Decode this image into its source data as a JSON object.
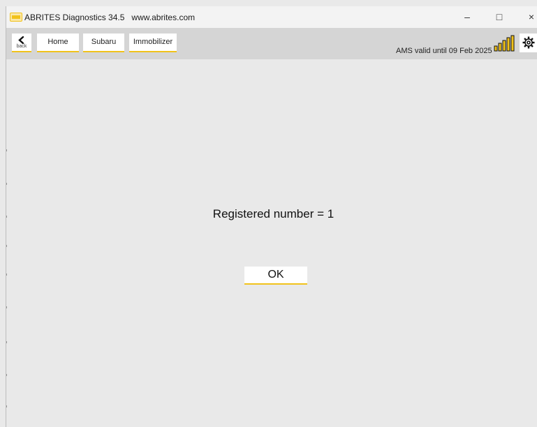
{
  "window": {
    "title": "ABRITES Diagnostics 34.5",
    "url": "www.abrites.com",
    "minimize_glyph": "–",
    "maximize_glyph": "□",
    "close_glyph": "×"
  },
  "toolbar": {
    "back_label": "back",
    "breadcrumbs": [
      "Home",
      "Subaru",
      "Immobilizer"
    ],
    "ams_status": "AMS valid until 09 Feb 2025"
  },
  "dialog": {
    "message": "Registered number = 1",
    "ok_label": "OK"
  },
  "icons": {
    "logo": "abrites-logo-icon",
    "back": "chevron-left-icon",
    "signal": "signal-strength-icon",
    "settings": "gear-icon"
  },
  "colors": {
    "accent": "#f1c21b",
    "background": "#e9e9e9",
    "toolbar": "#d5d5d5",
    "titlebar": "#f3f3f3"
  }
}
